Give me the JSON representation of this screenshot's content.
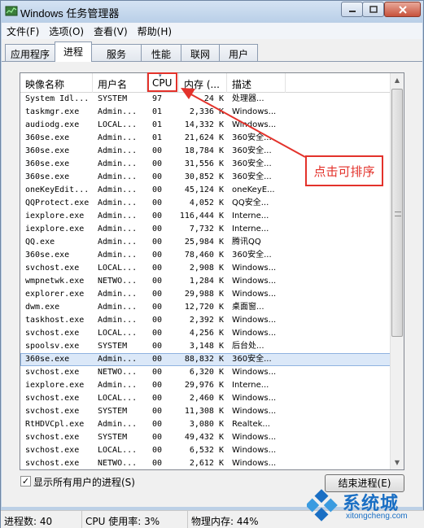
{
  "window": {
    "title": "Windows 任务管理器"
  },
  "menu": [
    "文件(F)",
    "选项(O)",
    "查看(V)",
    "帮助(H)"
  ],
  "tabs": [
    "应用程序",
    "进程",
    "服务",
    "性能",
    "联网",
    "用户"
  ],
  "active_tab": "进程",
  "columns": [
    "映像名称",
    "用户名",
    "CPU",
    "内存 (...",
    "描述"
  ],
  "processes": [
    {
      "name": "System Idl...",
      "user": "SYSTEM",
      "cpu": "97",
      "mem": "24 K",
      "desc": "处理器..."
    },
    {
      "name": "taskmgr.exe",
      "user": "Admin...",
      "cpu": "01",
      "mem": "2,336 K",
      "desc": "Windows..."
    },
    {
      "name": "audiodg.exe",
      "user": "LOCAL...",
      "cpu": "01",
      "mem": "14,332 K",
      "desc": "Windows..."
    },
    {
      "name": "360se.exe",
      "user": "Admin...",
      "cpu": "01",
      "mem": "21,624 K",
      "desc": "360安全..."
    },
    {
      "name": "360se.exe",
      "user": "Admin...",
      "cpu": "00",
      "mem": "18,784 K",
      "desc": "360安全..."
    },
    {
      "name": "360se.exe",
      "user": "Admin...",
      "cpu": "00",
      "mem": "31,556 K",
      "desc": "360安全..."
    },
    {
      "name": "360se.exe",
      "user": "Admin...",
      "cpu": "00",
      "mem": "30,852 K",
      "desc": "360安全..."
    },
    {
      "name": "oneKeyEdit...",
      "user": "Admin...",
      "cpu": "00",
      "mem": "45,124 K",
      "desc": "oneKeyE..."
    },
    {
      "name": "QQProtect.exe",
      "user": "Admin...",
      "cpu": "00",
      "mem": "4,052 K",
      "desc": "QQ安全..."
    },
    {
      "name": "iexplore.exe",
      "user": "Admin...",
      "cpu": "00",
      "mem": "116,444 K",
      "desc": "Interne..."
    },
    {
      "name": "iexplore.exe",
      "user": "Admin...",
      "cpu": "00",
      "mem": "7,732 K",
      "desc": "Interne..."
    },
    {
      "name": "QQ.exe",
      "user": "Admin...",
      "cpu": "00",
      "mem": "25,984 K",
      "desc": "腾讯QQ"
    },
    {
      "name": "360se.exe",
      "user": "Admin...",
      "cpu": "00",
      "mem": "78,460 K",
      "desc": "360安全..."
    },
    {
      "name": "svchost.exe",
      "user": "LOCAL...",
      "cpu": "00",
      "mem": "2,908 K",
      "desc": "Windows..."
    },
    {
      "name": "wmpnetwk.exe",
      "user": "NETWO...",
      "cpu": "00",
      "mem": "1,284 K",
      "desc": "Windows..."
    },
    {
      "name": "explorer.exe",
      "user": "Admin...",
      "cpu": "00",
      "mem": "29,988 K",
      "desc": "Windows..."
    },
    {
      "name": "dwm.exe",
      "user": "Admin...",
      "cpu": "00",
      "mem": "12,720 K",
      "desc": "桌面窗..."
    },
    {
      "name": "taskhost.exe",
      "user": "Admin...",
      "cpu": "00",
      "mem": "2,392 K",
      "desc": "Windows..."
    },
    {
      "name": "svchost.exe",
      "user": "LOCAL...",
      "cpu": "00",
      "mem": "4,256 K",
      "desc": "Windows..."
    },
    {
      "name": "spoolsv.exe",
      "user": "SYSTEM",
      "cpu": "00",
      "mem": "3,148 K",
      "desc": "后台处..."
    },
    {
      "name": "360se.exe",
      "user": "Admin...",
      "cpu": "00",
      "mem": "88,832 K",
      "desc": "360安全...",
      "selected": true
    },
    {
      "name": "svchost.exe",
      "user": "NETWO...",
      "cpu": "00",
      "mem": "6,320 K",
      "desc": "Windows..."
    },
    {
      "name": "iexplore.exe",
      "user": "Admin...",
      "cpu": "00",
      "mem": "29,976 K",
      "desc": "Interne..."
    },
    {
      "name": "svchost.exe",
      "user": "LOCAL...",
      "cpu": "00",
      "mem": "2,460 K",
      "desc": "Windows..."
    },
    {
      "name": "svchost.exe",
      "user": "SYSTEM",
      "cpu": "00",
      "mem": "11,308 K",
      "desc": "Windows..."
    },
    {
      "name": "RtHDVCpl.exe",
      "user": "Admin...",
      "cpu": "00",
      "mem": "3,080 K",
      "desc": "Realtek..."
    },
    {
      "name": "svchost.exe",
      "user": "SYSTEM",
      "cpu": "00",
      "mem": "49,432 K",
      "desc": "Windows..."
    },
    {
      "name": "svchost.exe",
      "user": "LOCAL...",
      "cpu": "00",
      "mem": "6,532 K",
      "desc": "Windows..."
    },
    {
      "name": "svchost.exe",
      "user": "NETWO...",
      "cpu": "00",
      "mem": "2,612 K",
      "desc": "Windows..."
    }
  ],
  "annotation": {
    "callout_text": "点击可排序",
    "color": "#e3322b"
  },
  "show_all_users": {
    "label": "显示所有用户的进程(S)",
    "checked": true
  },
  "end_process_button": "结束进程(E)",
  "status": {
    "processes": "进程数: 40",
    "cpu": "CPU 使用率: 3%",
    "memory": "物理内存: 44%"
  },
  "watermark": {
    "text": "系统城",
    "sub": "xitongcheng.com"
  },
  "colors": {
    "accent": "#e3322b",
    "selection": "#dbe8f8",
    "watermark": "#1a6fc4"
  }
}
